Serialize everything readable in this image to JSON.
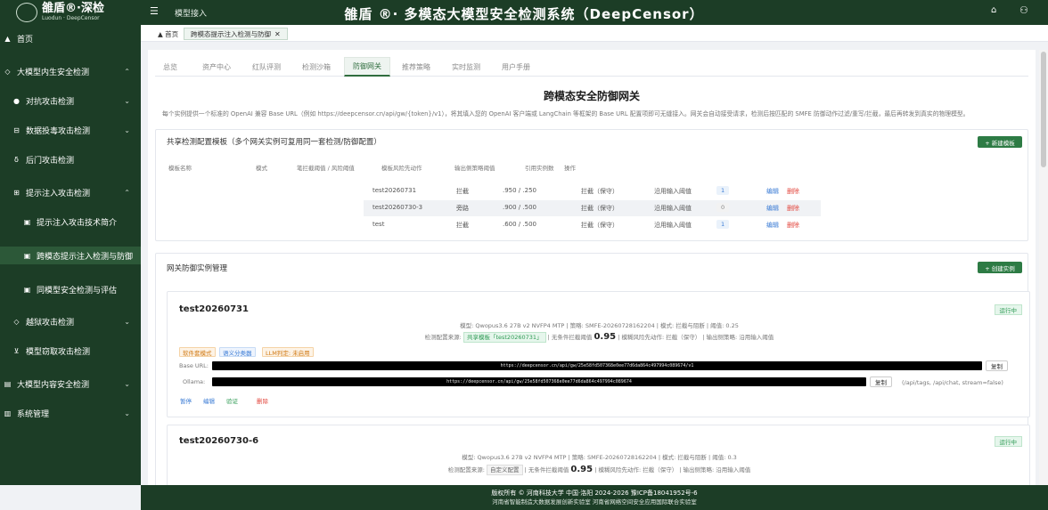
{
  "header": {
    "logo_name": "雒盾®·深检",
    "logo_sub": "Luodun · DeepCensor",
    "menu_icon": "☰",
    "breadcrumb": "模型接入",
    "system_title": "雒盾 ®· 多模态大模型安全检测系统（DeepCensor）",
    "home_icon": "⌂",
    "user_icon": "⚇"
  },
  "sidebar": {
    "items": [
      {
        "label": "首页",
        "icon": "▲"
      },
      {
        "label": "大模型内生安全检测",
        "icon": "◇",
        "arrow": "⌃"
      },
      {
        "label": "对抗攻击检测",
        "icon": "●",
        "arrow": "⌄"
      },
      {
        "label": "数据投毒攻击检测",
        "icon": "⊟",
        "arrow": "⌄"
      },
      {
        "label": "后门攻击检测",
        "icon": "δ"
      },
      {
        "label": "提示注入攻击检测",
        "icon": "⊞",
        "arrow": "⌃"
      },
      {
        "label": "提示注入攻击技术简介",
        "icon": "▣"
      },
      {
        "label": "跨模态提示注入检测与防御",
        "icon": "▣"
      },
      {
        "label": "同模型安全检测与评估",
        "icon": "▣"
      },
      {
        "label": "越狱攻击检测",
        "icon": "◇",
        "arrow": "⌄"
      },
      {
        "label": "模型窃取攻击检测",
        "icon": "⊻"
      },
      {
        "label": "大模型内容安全检测",
        "icon": "▤",
        "arrow": "⌄"
      },
      {
        "label": "系统管理",
        "icon": "▥",
        "arrow": "⌄"
      }
    ]
  },
  "page_tabs": {
    "home": "▲ 首页",
    "current": "跨模态提示注入检测与防御",
    "close": "✕"
  },
  "subtabs": [
    "总览",
    "资产中心",
    "红队评测",
    "检测沙箱",
    "防御网关",
    "推荐策略",
    "实时监测",
    "用户手册"
  ],
  "main": {
    "title": "跨模态安全防御网关",
    "description": "每个实例提供一个标准的 OpenAI 兼容 Base URL（例如 https://deepcensor.cn/api/gw/{token}/v1），将其填入您的 OpenAI 客户端或 LangChain 等框架的 Base URL 配置项即可无缝接入。网关会自动接受请求，检测后按匹配的 SMFE 防御动作过滤/重写/拦截，最后再转发到真实的物理模型。"
  },
  "shared_config": {
    "title": "共享检测配置模板（多个网关实例可复用同一套检测/防御配置）",
    "new_button": "+ 新建模板",
    "headers": [
      "模板名称",
      "模式",
      "笔拦截阈值 / 风险阈值",
      "模板风险先动作",
      "输出侧策略阈值",
      "引用实例数",
      "操作"
    ],
    "rows": [
      {
        "name": "test20260731",
        "mode": "拦截",
        "threshold": ".950 / .250",
        "action": "拦截（保守）",
        "output": "沿用输入阈值",
        "count": "1",
        "edit": "编辑",
        "delete": "删除"
      },
      {
        "name": "test20260730-3",
        "mode": "旁路",
        "threshold": ".900 / .500",
        "action": "拦截（保守）",
        "output": "沿用输入阈值",
        "count": "0",
        "edit": "编辑",
        "delete": "删除"
      },
      {
        "name": "test",
        "mode": "拦截",
        "threshold": ".600 / .500",
        "action": "拦截（保守）",
        "output": "沿用输入阈值",
        "count": "1",
        "edit": "编辑",
        "delete": "删除"
      }
    ]
  },
  "instances_panel": {
    "title": "网关防御实例管理",
    "create_button": "+ 创建实例"
  },
  "instances": [
    {
      "name": "test20260731",
      "status": "运行中",
      "meta": "模型: Qwopus3.6 27B v2 NVFP4 MTP  |  策略: SMFE-20260728162204  |  模式: 拦截与阻断  |  阈值: 0.25",
      "config_prefix": "检测配置来源:",
      "config_source": "共享模板「test20260731」",
      "threshold_label": "| 无条件拦截阈值",
      "threshold_value": "0.95",
      "config_suffix": "| 模糊风险先动作: 拦截（保守） | 输出侧策略: 沿用输入阈值",
      "tags": [
        "软件套模式",
        "语义分类器",
        "LLM判定: 未启用"
      ],
      "base_url_label": "Base URL:",
      "base_url": "https://deepcensor.cn/api/gw/25e58fd507368e0ee77d6da864c497994c089674/v1",
      "copy": "复制",
      "ollama_label": "Ollama:",
      "ollama_url": "https://deepcensor.cn/api/gw/25e58fd507368e0ee77d6da864c497994c089674",
      "ollama_note": "(/api/tags, /api/chat, stream=false)",
      "actions": [
        "暂停",
        "编辑",
        "验证",
        "删除"
      ]
    },
    {
      "name": "test20260730-6",
      "status": "运行中",
      "meta": "模型: Qwopus3.6 27B v2 NVFP4 MTP  |  策略: SMFE-20260728162204  |  模式: 拦截与阻断  |  阈值: 0.3",
      "config_prefix": "检测配置来源:",
      "config_source": "自定义配置",
      "threshold_label": "| 无条件拦截阈值",
      "threshold_value": "0.95",
      "config_suffix": "| 模糊风险先动作: 拦截（保守） | 输出侧策略: 沿用输入阈值"
    }
  ],
  "footer": {
    "line1": "版权所有 © 河南科技大学  中国·洛阳  2024-2026    豫ICP备18041952号-6",
    "line2": "河南省智能制造大数据发展创新实验室  河南省网络空间安全应用国际联合实验室"
  },
  "colors": {
    "brand": "#1c3d26",
    "accent": "#2d7b44",
    "link": "#3a7bd5",
    "danger": "#e2453c",
    "running": "#2d9a53"
  }
}
